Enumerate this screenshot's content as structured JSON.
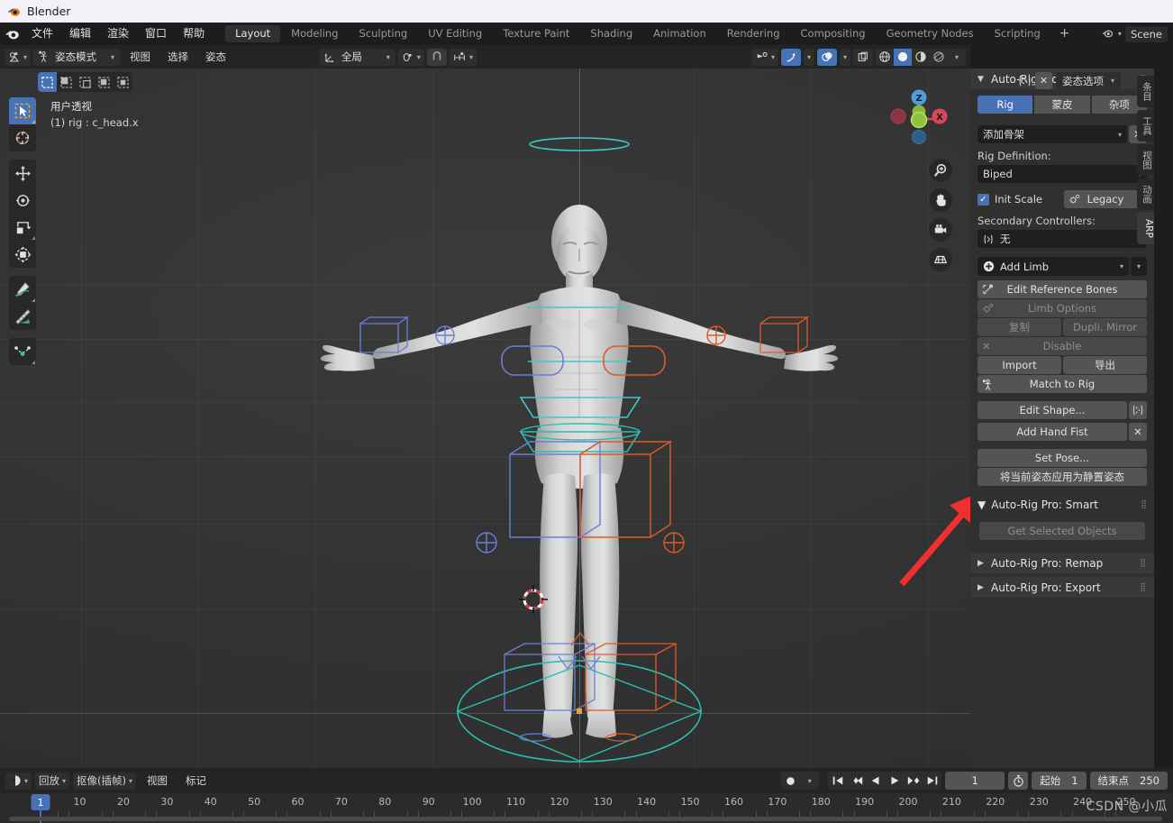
{
  "window": {
    "title": "Blender",
    "icon": "blender-logo-icon"
  },
  "topbar": {
    "menus": [
      "文件",
      "编辑",
      "渲染",
      "窗口",
      "帮助"
    ],
    "workspaces": [
      {
        "label": "Layout",
        "active": true
      },
      {
        "label": "Modeling",
        "active": false
      },
      {
        "label": "Sculpting",
        "active": false
      },
      {
        "label": "UV Editing",
        "active": false
      },
      {
        "label": "Texture Paint",
        "active": false
      },
      {
        "label": "Shading",
        "active": false
      },
      {
        "label": "Animation",
        "active": false
      },
      {
        "label": "Rendering",
        "active": false
      },
      {
        "label": "Compositing",
        "active": false
      },
      {
        "label": "Geometry Nodes",
        "active": false
      },
      {
        "label": "Scripting",
        "active": false
      }
    ],
    "add_workspace": "+",
    "scene_name": "Scene"
  },
  "viewport_header": {
    "editor_type_icon": "editor-type-icon",
    "mode": "姿态模式",
    "menus": [
      "视图",
      "选择",
      "姿态"
    ],
    "transform_orientation": "全局",
    "snap_icon": "snap-magnet-icon",
    "proportional_icon": "proportional-edit-icon",
    "select_modes": [
      "select-set",
      "select-extend",
      "select-subtract",
      "select-invert",
      "select-intersect"
    ],
    "overlay_label": "姿态选项"
  },
  "viewport": {
    "view_name": "用户透视",
    "object_info": "(1) rig : c_head.x",
    "gizmo_axes": [
      "Z",
      "Y",
      "X"
    ],
    "nav_buttons": [
      "zoom-icon",
      "pan-hand-icon",
      "camera-icon",
      "grid-ortho-icon"
    ],
    "tools": [
      "tweak-cursor-tool",
      "cursor-tool",
      "move-tool",
      "rotate-tool",
      "scale-tool",
      "transform-tool",
      "annotate-tool",
      "measure-tool",
      "bendy-bone-tool"
    ],
    "annotation": {
      "type": "red-arrow",
      "color": "#f03030"
    }
  },
  "panel_tabs": [
    {
      "label": "条目",
      "active": false
    },
    {
      "label": "工具",
      "active": false
    },
    {
      "label": "视图",
      "active": false
    },
    {
      "label": "动画",
      "active": false
    },
    {
      "label": "ARP",
      "active": true
    }
  ],
  "arp": {
    "title": "Auto-Rig Pro",
    "tabs": [
      {
        "label": "Rig",
        "active": true
      },
      {
        "label": "蒙皮",
        "active": false
      },
      {
        "label": "杂项",
        "active": false
      }
    ],
    "armature_field": "添加骨架",
    "armature_clear": "✕",
    "rig_definition_label": "Rig Definition:",
    "rig_definition_value": "Biped",
    "init_scale_label": "Init Scale",
    "init_scale_checked": true,
    "legacy_label": "Legacy",
    "secondary_controllers_label": "Secondary Controllers:",
    "secondary_controllers_value": "无",
    "add_limb": "Add Limb",
    "edit_reference_bones": "Edit Reference Bones",
    "limb_options": "Limb Options",
    "duplicate": "复制",
    "dupli_mirror": "Dupli. Mirror",
    "disable": "Disable",
    "import": "Import",
    "export": "导出",
    "match_to_rig": "Match to Rig",
    "edit_shape": "Edit Shape...",
    "add_hand_fist": "Add Hand Fist",
    "add_hand_fist_clear": "✕",
    "set_pose": "Set Pose...",
    "apply_rest_pose": "将当前姿态应用为静置姿态",
    "smart_title": "Auto-Rig Pro: Smart",
    "get_selected_objects": "Get Selected Objects",
    "remap_title": "Auto-Rig Pro: Remap",
    "export_title": "Auto-Rig Pro: Export",
    "accent": "#4772b3"
  },
  "timeline": {
    "editor_icon": "timeline-editor-icon",
    "menus": [
      "回放",
      "抠像(插帧)",
      "视图",
      "标记"
    ],
    "record_icon": "auto-keying-record-icon",
    "playback_buttons": [
      "jump-to-start",
      "prev-keyframe",
      "play-reverse",
      "play",
      "next-keyframe",
      "jump-to-end"
    ],
    "current_frame": "1",
    "use_preview_range_icon": "stopwatch-icon",
    "start_label": "起始",
    "start_value": "1",
    "end_label": "结束点",
    "end_value": "250",
    "ticks": [
      10,
      20,
      30,
      40,
      50,
      60,
      70,
      80,
      90,
      100,
      110,
      120,
      130,
      140,
      150,
      160,
      170,
      180,
      190,
      200,
      210,
      220,
      230,
      240,
      250
    ],
    "playhead_frame": "1"
  },
  "watermark": "CSDN @小瓜"
}
